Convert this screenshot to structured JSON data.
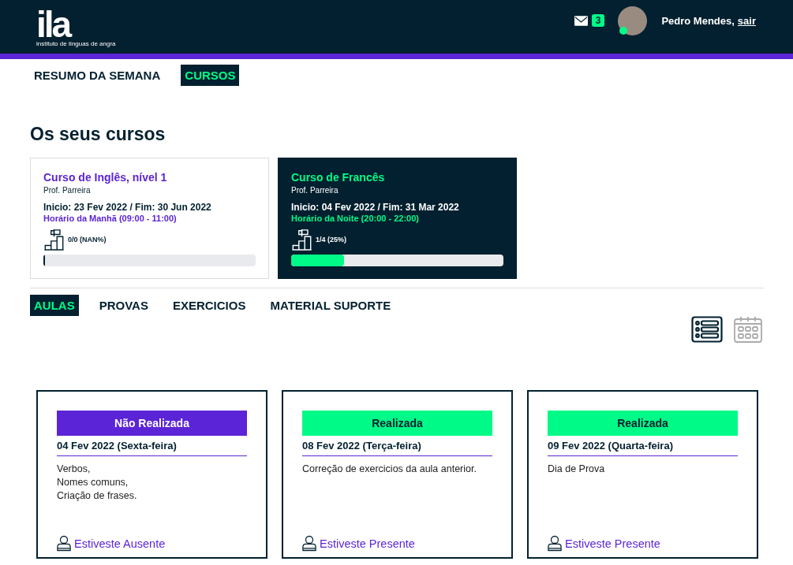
{
  "header": {
    "logo": {
      "mark": "ila",
      "subtitle": "instituto de línguas de angra"
    },
    "messages_count": "3",
    "user": {
      "name": "Pedro Mendes,",
      "logout": "sair",
      "online": true
    }
  },
  "nav": [
    {
      "label": "RESUMO DA SEMANA",
      "selected": false
    },
    {
      "label": "CURSOS",
      "selected": true
    }
  ],
  "heading": "Os seus cursos",
  "courses": [
    {
      "title": "Curso de Inglês, nível 1",
      "teacher": "Prof. Parreira",
      "dates": "Inicio: 23 Fev 2022 / Fim: 30 Jun 2022",
      "schedule": "Horário da Manhã (09:00 - 11:00)",
      "progress": "0/0 (NAN%)",
      "level": 0,
      "selected": false
    },
    {
      "title": "Curso de Francês",
      "teacher": "Prof. Parreira",
      "dates": "Inicio: 04 Fev 2022 / Fim: 31 Mar 2022",
      "schedule": "Horário da Noite (20:00 - 22:00)",
      "progress": "1/4 (25%)",
      "level": 0.25,
      "selected": true
    }
  ],
  "tabs": [
    {
      "label": "AULAS",
      "selected": true
    },
    {
      "label": "PROVAS",
      "selected": false
    },
    {
      "label": "EXERCICIOS",
      "selected": false
    },
    {
      "label": "MATERIAL SUPORTE",
      "selected": false
    }
  ],
  "view_toggle": [
    {
      "kind": "list",
      "selected": true
    },
    {
      "kind": "calendar",
      "selected": false
    }
  ],
  "lessons": [
    {
      "status": "Não Realizada",
      "done": false,
      "date": "04 Fev 2022 (Sexta-feira)",
      "lines": [
        "Verbos,",
        "Nomes comuns,",
        "Criação de frases."
      ],
      "attendance": "Estiveste Ausente"
    },
    {
      "status": "Realizada",
      "done": true,
      "date": "08 Fev 2022 (Terça-feira)",
      "lines": [
        "Correção de exercicios da aula anterior."
      ],
      "attendance": "Estiveste Presente"
    },
    {
      "status": "Realizada",
      "done": true,
      "date": "09 Fev 2022 (Quarta-feira)",
      "lines": [
        "Dia de Prova"
      ],
      "attendance": "Estiveste Presente"
    }
  ]
}
